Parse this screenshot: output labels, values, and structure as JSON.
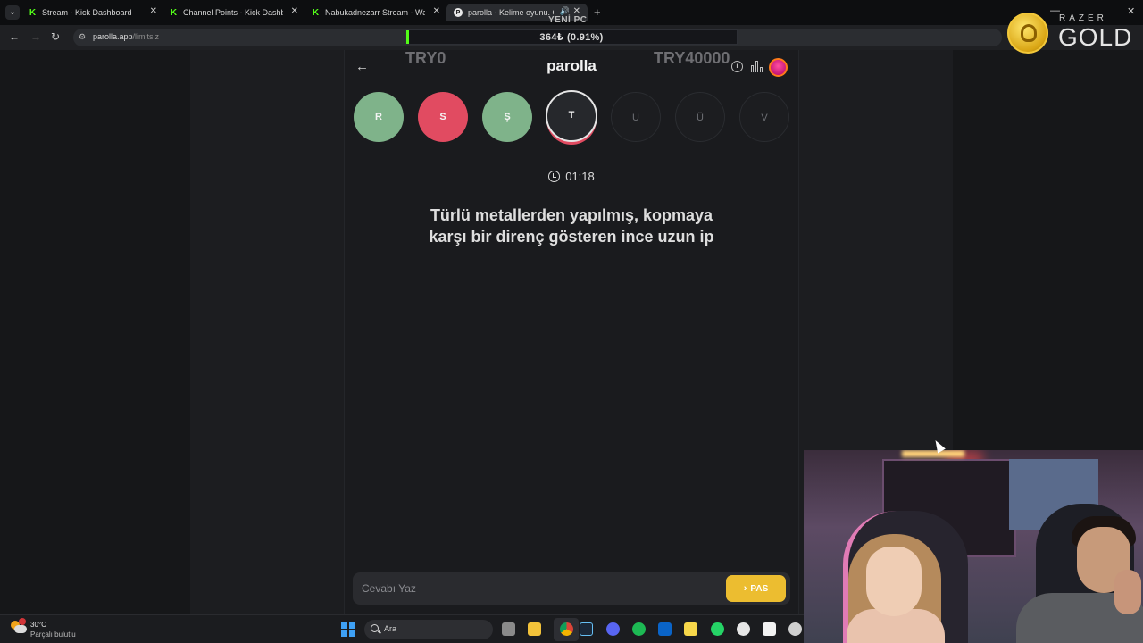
{
  "browser": {
    "tabs": [
      {
        "title": "Stream - Kick Dashboard",
        "favicon": "kick-icon"
      },
      {
        "title": "Channel Points - Kick Dashboard",
        "favicon": "kick-icon"
      },
      {
        "title": "Nabukadnezarr Stream - Watch",
        "favicon": "kick-icon"
      },
      {
        "title": "parolla - Kelime oyunu. Gü",
        "favicon": "parolla-icon",
        "active": true
      }
    ],
    "new_tab_label": "+",
    "url_host": "parolla.app",
    "url_path": "/limitsiz"
  },
  "overlays": {
    "goal_title": "YENİ PC",
    "goal_text": "364₺ (0.91%)",
    "goal_percent": 0.91,
    "goal_min": "TRY0",
    "goal_max": "TRY40000",
    "sponsor_brand": "RAZER",
    "sponsor_gold": "GOLD"
  },
  "game": {
    "brand": "parolla",
    "letters": [
      {
        "letter": "R",
        "state": "correct"
      },
      {
        "letter": "S",
        "state": "wrong"
      },
      {
        "letter": "Ş",
        "state": "correct"
      },
      {
        "letter": "T",
        "state": "current"
      },
      {
        "letter": "U",
        "state": "pending"
      },
      {
        "letter": "Ü",
        "state": "pending"
      },
      {
        "letter": "V",
        "state": "pending"
      }
    ],
    "timer": "01:18",
    "question_line1": "Türlü metallerden yapılmış, kopmaya",
    "question_line2": "karşı bir direnç gösteren ince uzun ip",
    "answer_placeholder": "Cevabı Yaz",
    "pass_label": "PAS"
  },
  "taskbar": {
    "weather_temp": "30°C",
    "weather_desc": "Parçalı bulutlu",
    "search_label": "Ara"
  },
  "colors": {
    "correct": "#7fb38a",
    "wrong": "#e14b61",
    "pass_button": "#ecbd30",
    "kick_green": "#53fc18"
  }
}
